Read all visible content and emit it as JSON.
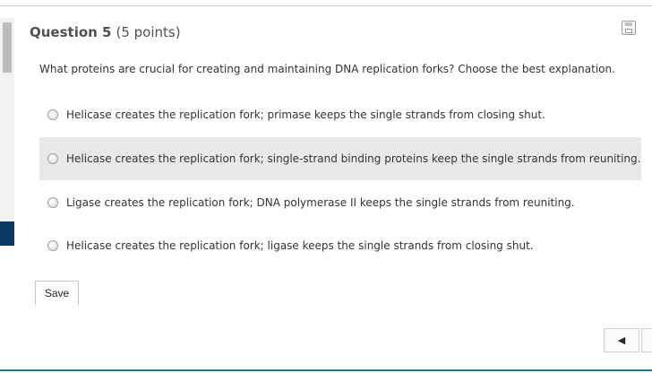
{
  "question": {
    "title": "Question 5",
    "points": "(5 points)",
    "prompt": "What proteins are crucial for creating and maintaining DNA replication forks? Choose the best explanation."
  },
  "options": [
    {
      "text": "Helicase creates the replication fork; primase keeps the single strands from closing shut.",
      "selected": false
    },
    {
      "text": "Helicase creates the replication fork; single-strand binding proteins keep the single strands from reuniting.",
      "selected": false
    },
    {
      "text": "Ligase creates the replication fork; DNA polymerase II keeps the single strands from reuniting.",
      "selected": false
    },
    {
      "text": "Helicase creates the replication fork; ligase keeps the single strands from closing shut.",
      "selected": false
    }
  ],
  "save_button": {
    "label": "Save"
  },
  "navigation": {
    "prev_glyph": "◀"
  },
  "colors": {
    "rail_accent": "#0c3760",
    "bottom_bar": "#2a7a86",
    "option_hover": "#e9e9e9"
  },
  "icons": {
    "top_right": "floppy-disk-icon",
    "prev": "triangle-left-icon"
  }
}
